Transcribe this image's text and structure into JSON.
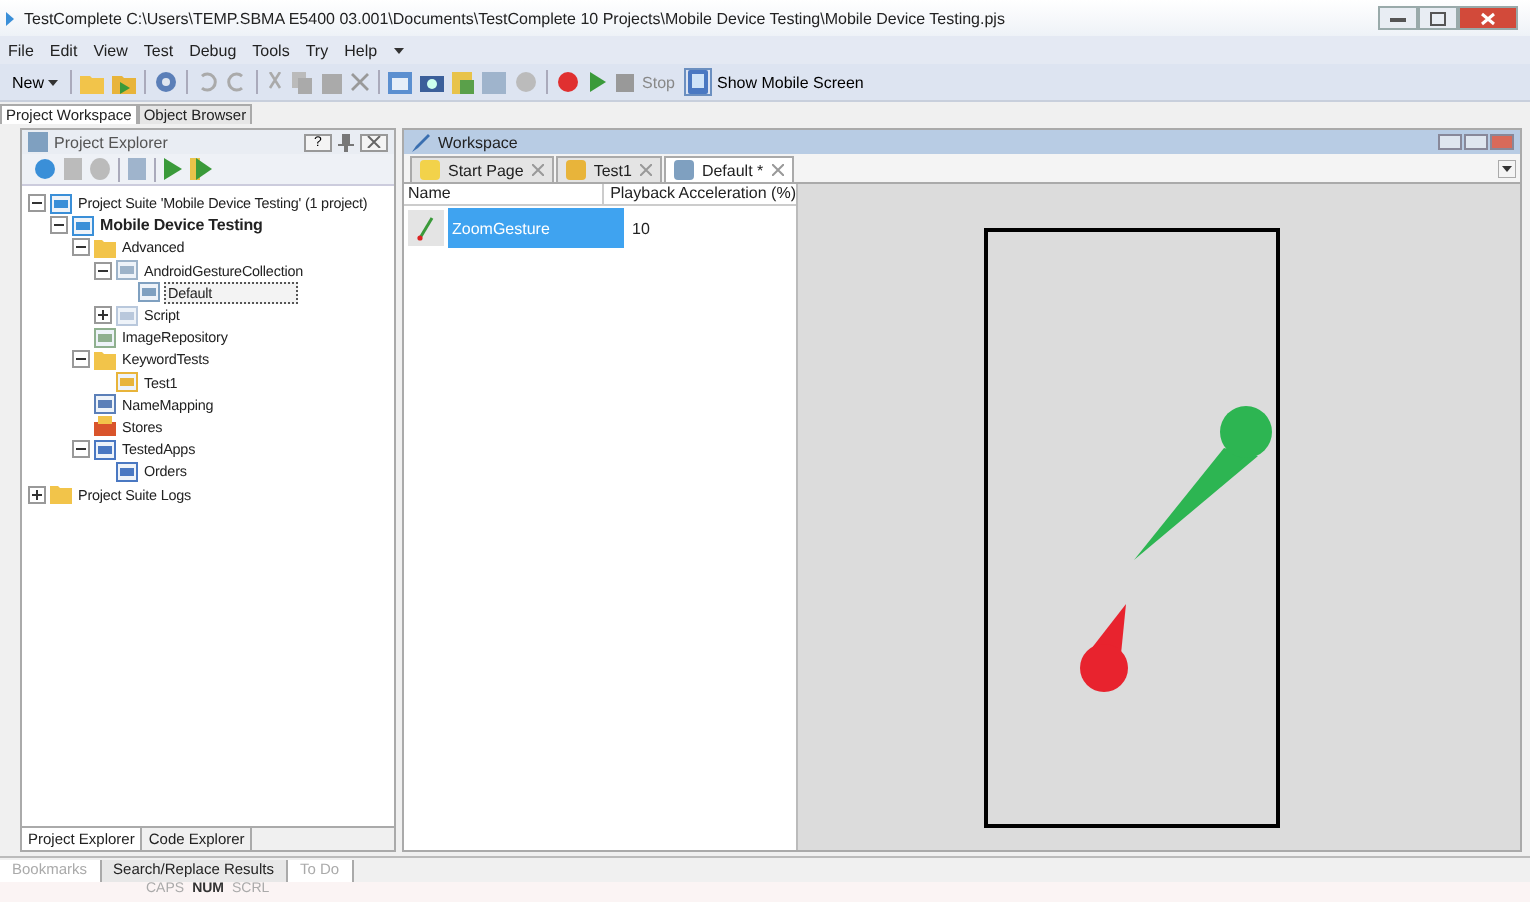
{
  "window": {
    "title": "TestComplete   C:\\Users\\TEMP.SBMA  E5400  03.001\\Documents\\TestComplete 10 Projects\\Mobile Device Testing\\Mobile Device Testing.pjs"
  },
  "menu": [
    "File",
    "Edit",
    "View",
    "Test",
    "Debug",
    "Tools",
    "Try",
    "Help"
  ],
  "toolbar": {
    "new_label": "New",
    "stop_label": "Stop",
    "show_mobile_label": "Show Mobile Screen",
    "show_mobile_on": true
  },
  "doc_tabs": [
    {
      "label": "Project Workspace",
      "selected": true
    },
    {
      "label": "Object Browser",
      "selected": false
    }
  ],
  "explorer": {
    "title": "Project Explorer",
    "help": "?",
    "tree": [
      {
        "label": "Project Suite 'Mobile Device Testing' (1 project)",
        "kind": "suite",
        "expanded": true,
        "children": [
          {
            "label": "Mobile Device Testing",
            "kind": "project",
            "bold": true,
            "expanded": true,
            "children": [
              {
                "label": "Advanced",
                "kind": "folder",
                "expanded": true,
                "children": [
                  {
                    "label": "AndroidGestureCollection",
                    "kind": "collection",
                    "expanded": true,
                    "children": [
                      {
                        "label": "Default",
                        "kind": "item",
                        "selected": true
                      }
                    ]
                  },
                  {
                    "label": "Script",
                    "kind": "script",
                    "expanded": false
                  }
                ]
              },
              {
                "label": "ImageRepository",
                "kind": "repository"
              },
              {
                "label": "KeywordTests",
                "kind": "folder",
                "expanded": true,
                "children": [
                  {
                    "label": "Test1",
                    "kind": "test"
                  }
                ]
              },
              {
                "label": "NameMapping",
                "kind": "mapping"
              },
              {
                "label": "Stores",
                "kind": "stores"
              },
              {
                "label": "TestedApps",
                "kind": "apps",
                "expanded": true,
                "children": [
                  {
                    "label": "Orders",
                    "kind": "app"
                  }
                ]
              }
            ]
          }
        ]
      },
      {
        "label": "Project Suite Logs",
        "kind": "folder",
        "expanded": false
      }
    ],
    "bottom_tabs": [
      {
        "label": "Project Explorer",
        "selected": true
      },
      {
        "label": "Code Explorer",
        "selected": false
      }
    ]
  },
  "workspace": {
    "title": "Workspace",
    "tabs": [
      {
        "label": "Start Page",
        "kind": "start",
        "selected": false
      },
      {
        "label": "Test1",
        "kind": "test",
        "selected": false
      },
      {
        "label": "Default *",
        "kind": "item",
        "selected": true
      }
    ],
    "columns": [
      "Name",
      "Playback Acceleration (%)"
    ],
    "rows": [
      {
        "name": "ZoomGesture",
        "acceleration": "10",
        "selected": true
      }
    ]
  },
  "output_tabs": [
    {
      "label": "Bookmarks",
      "disabled": true,
      "selected": false
    },
    {
      "label": "Search/Replace Results",
      "disabled": false,
      "selected": true
    },
    {
      "label": "To Do",
      "disabled": true,
      "selected": false
    }
  ],
  "status_bar": [
    {
      "label": "CAPS",
      "on": false
    },
    {
      "label": "NUM",
      "on": true
    },
    {
      "label": "SCRL",
      "on": false
    }
  ]
}
